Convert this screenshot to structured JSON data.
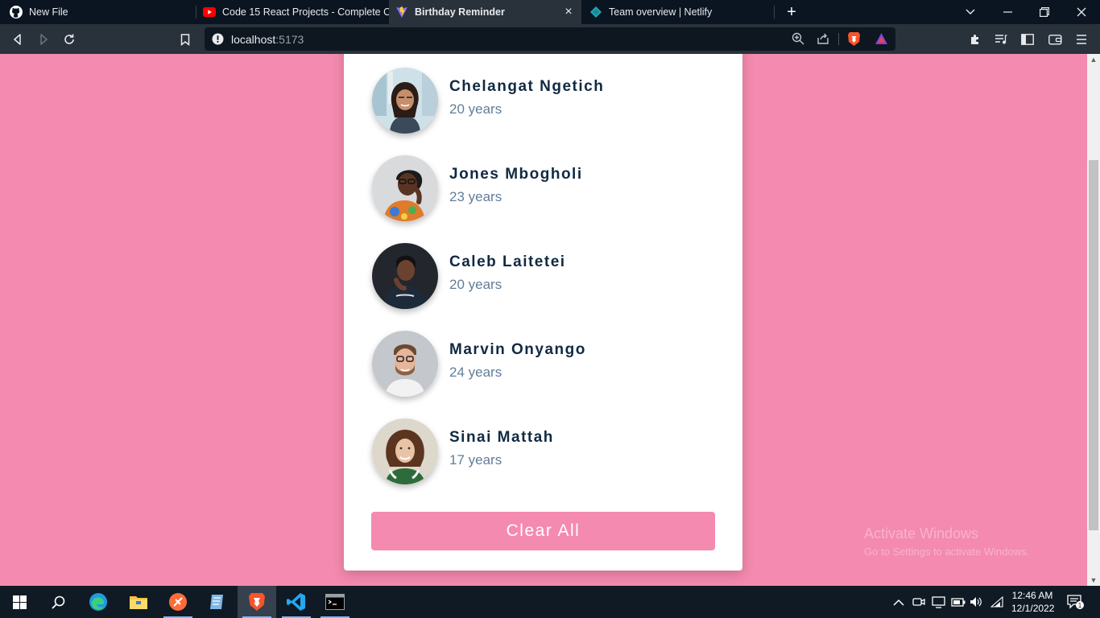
{
  "browser": {
    "tabs": [
      {
        "title": "New File",
        "icon": "github-icon",
        "active": false
      },
      {
        "title": "Code 15 React Projects - Complete Co",
        "icon": "youtube-icon",
        "active": false
      },
      {
        "title": "Birthday Reminder",
        "icon": "vite-icon",
        "active": true
      },
      {
        "title": "Team overview | Netlify",
        "icon": "netlify-icon",
        "active": false
      }
    ],
    "url_host": "localhost",
    "url_port": ":5173"
  },
  "app": {
    "people": [
      {
        "name": "Chelangat Ngetich",
        "age": "20 years"
      },
      {
        "name": "Jones Mbogholi",
        "age": "23 years"
      },
      {
        "name": "Caleb Laitetei",
        "age": "20 years"
      },
      {
        "name": "Marvin Onyango",
        "age": "24 years"
      },
      {
        "name": "Sinai Mattah",
        "age": "17 years"
      }
    ],
    "clear_label": "Clear All"
  },
  "watermark": {
    "line1": "Activate Windows",
    "line2": "Go to Settings to activate Windows."
  },
  "taskbar": {
    "time": "12:46 AM",
    "date": "12/1/2022",
    "notification_count": "1"
  },
  "colors": {
    "page_background": "#f48aaf",
    "name_text": "#102a42",
    "age_text": "#617d98",
    "button": "#f48aaf"
  }
}
